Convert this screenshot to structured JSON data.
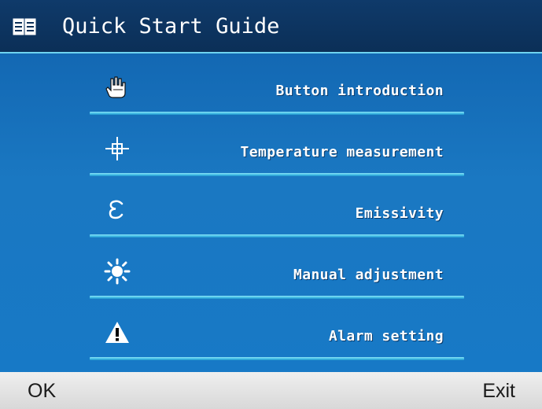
{
  "header": {
    "title": "Quick Start Guide",
    "icon": "book-icon"
  },
  "menu": {
    "items": [
      {
        "label": "Button introduction",
        "icon": "hand-press-icon"
      },
      {
        "label": "Temperature measurement",
        "icon": "crosshair-icon"
      },
      {
        "label": "Emissivity",
        "icon": "epsilon-icon"
      },
      {
        "label": "Manual adjustment",
        "icon": "brightness-icon"
      },
      {
        "label": "Alarm setting",
        "icon": "warning-icon"
      }
    ]
  },
  "softkeys": {
    "left": "OK",
    "right": "Exit"
  },
  "colors": {
    "title_bar": "#0b2f57",
    "menu_background": "#1779c6",
    "underline": "#3fbde6",
    "bottom_bar": "#e3e3e3"
  }
}
